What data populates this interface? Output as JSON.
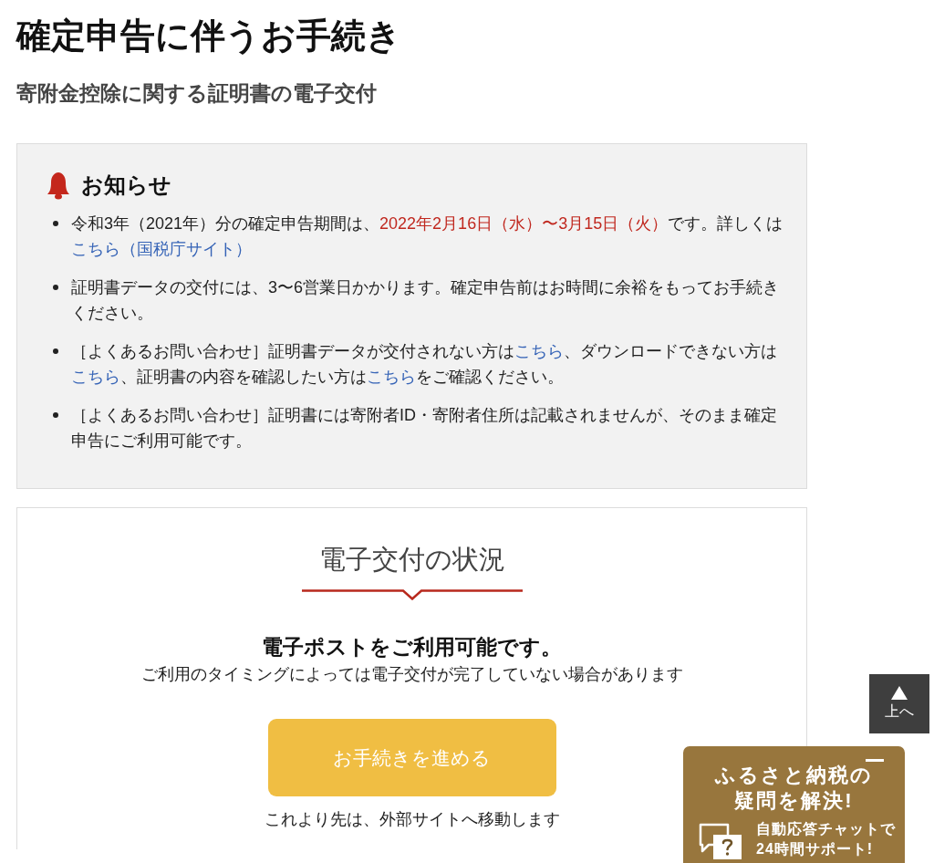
{
  "header": {
    "title": "確定申告に伴うお手続き",
    "subtitle": "寄附金控除に関する証明書の電子交付"
  },
  "notice": {
    "heading": "お知らせ",
    "items": [
      {
        "segments": [
          {
            "kind": "text",
            "text": "令和3年（2021年）分の確定申告期間は、"
          },
          {
            "kind": "highlight",
            "text": "2022年2月16日（水）〜3月15日（火）"
          },
          {
            "kind": "text",
            "text": "です。詳しくは"
          },
          {
            "kind": "link",
            "text": "こちら（国税庁サイト）"
          }
        ]
      },
      {
        "segments": [
          {
            "kind": "text",
            "text": "証明書データの交付には、3〜6営業日かかります。確定申告前はお時間に余裕をもってお手続きください。"
          }
        ]
      },
      {
        "segments": [
          {
            "kind": "text",
            "text": "［よくあるお問い合わせ］証明書データが交付されない方は"
          },
          {
            "kind": "link",
            "text": "こちら"
          },
          {
            "kind": "text",
            "text": "、ダウンロードできない方は"
          },
          {
            "kind": "link",
            "text": "こちら"
          },
          {
            "kind": "text",
            "text": "、証明書の内容を確認したい方は"
          },
          {
            "kind": "link",
            "text": "こちら"
          },
          {
            "kind": "text",
            "text": "をご確認ください。"
          }
        ]
      },
      {
        "segments": [
          {
            "kind": "text",
            "text": "［よくあるお問い合わせ］証明書には寄附者ID・寄附者住所は記載されませんが、そのまま確定申告にご利用可能です。"
          }
        ]
      }
    ]
  },
  "status": {
    "heading": "電子交付の状況",
    "message": "電子ポストをご利用可能です。",
    "note": "ご利用のタイミングによっては電子交付が完了していない場合があります",
    "button": "お手続きを進める",
    "footnote": "これより先は、外部サイトへ移動します"
  },
  "back_to_top": {
    "label": "上へ"
  },
  "chat_banner": {
    "title": "ふるさと納税の",
    "subtitle": "疑問を解決!",
    "lines": [
      "自動応答チャットで",
      "24時間サポート!"
    ]
  }
}
